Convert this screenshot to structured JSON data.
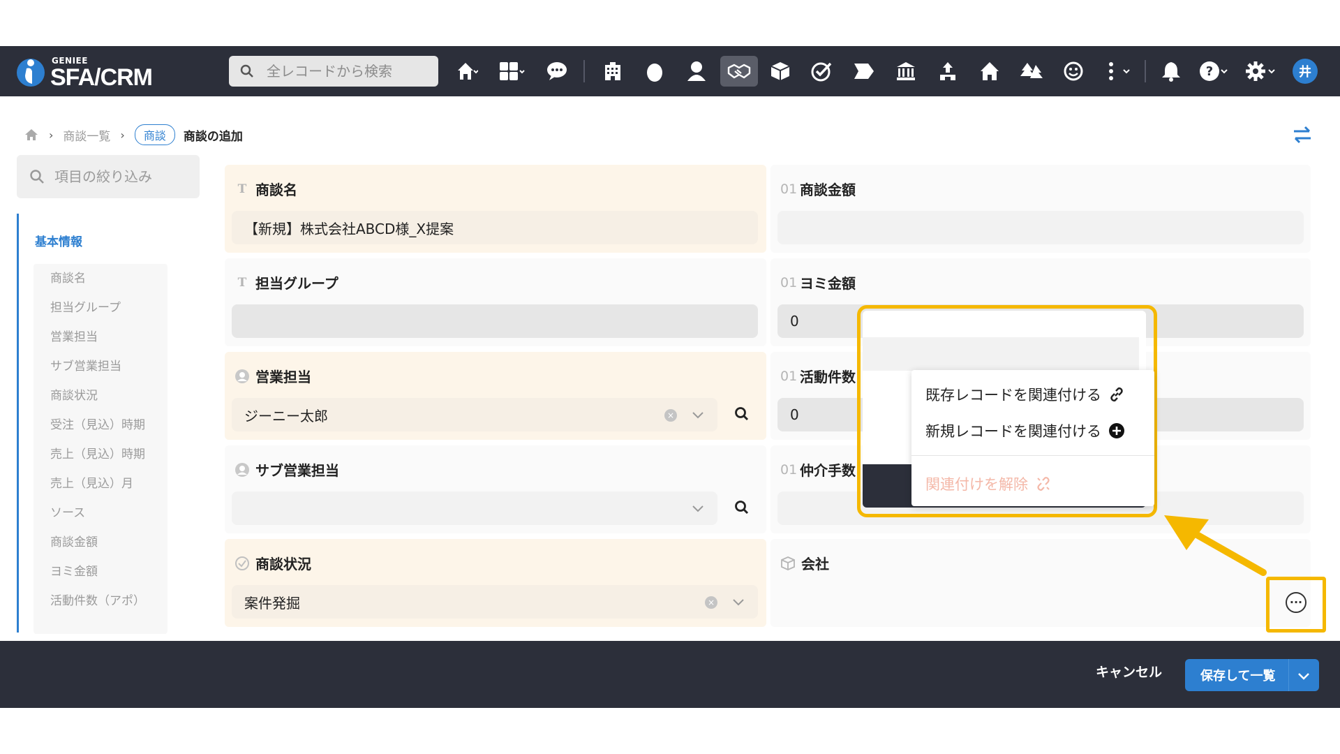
{
  "app": {
    "brand_sub": "GENIEE",
    "brand_main": "SFA/CRM",
    "search_placeholder": "全レコードから検索",
    "avatar_initial": "井"
  },
  "nav_icons": [
    "home-icon",
    "apps-grid-icon",
    "chat-icon",
    "building-icon",
    "egg-icon",
    "person-icon",
    "handshake-icon",
    "box-icon",
    "check-circle-icon",
    "tag-icon",
    "bank-icon",
    "org-icon",
    "house-icon",
    "tree-icon",
    "smile-icon",
    "more-vertical-icon",
    "bell-icon",
    "help-icon",
    "gear-icon"
  ],
  "breadcrumb": {
    "list": "商談一覧",
    "pill": "商談",
    "current": "商談の追加"
  },
  "left_panel": {
    "filter_placeholder": "項目の絞り込み",
    "section_title": "基本情報",
    "items": [
      "商談名",
      "担当グループ",
      "営業担当",
      "サブ営業担当",
      "商談状況",
      "受注（見込）時期",
      "売上（見込）時期",
      "売上（見込）月",
      "ソース",
      "商談金額",
      "ヨミ金額",
      "活動件数（アポ）"
    ]
  },
  "form": {
    "deal_name": {
      "label": "商談名",
      "value": "【新規】株式会社ABCD様_X提案"
    },
    "group": {
      "label": "担当グループ",
      "value": ""
    },
    "sales_rep": {
      "label": "営業担当",
      "value": "ジーニー太郎"
    },
    "sub_sales_rep": {
      "label": "サブ営業担当",
      "value": ""
    },
    "status": {
      "label": "商談状況",
      "value": "案件発掘"
    },
    "amount": {
      "label": "商談金額",
      "num": "01",
      "value": ""
    },
    "forecast": {
      "label": "ヨミ金額",
      "num": "01",
      "value": "0"
    },
    "activity": {
      "label": "活動件数",
      "num": "01",
      "value": "0"
    },
    "commission": {
      "label": "仲介手数",
      "num": "01",
      "value": ""
    },
    "company": {
      "label": "会社",
      "value": ""
    }
  },
  "context_menu": {
    "link_existing": "既存レコードを関連付ける",
    "link_new": "新規レコードを関連付ける",
    "unlink": "関連付けを解除"
  },
  "footer": {
    "cancel": "キャンセル",
    "save": "保存して一覧"
  },
  "colors": {
    "topbar": "#2c2f3a",
    "accent": "#2d7fd0",
    "highlight": "#f5b800",
    "required_card": "#fdf5e9"
  }
}
